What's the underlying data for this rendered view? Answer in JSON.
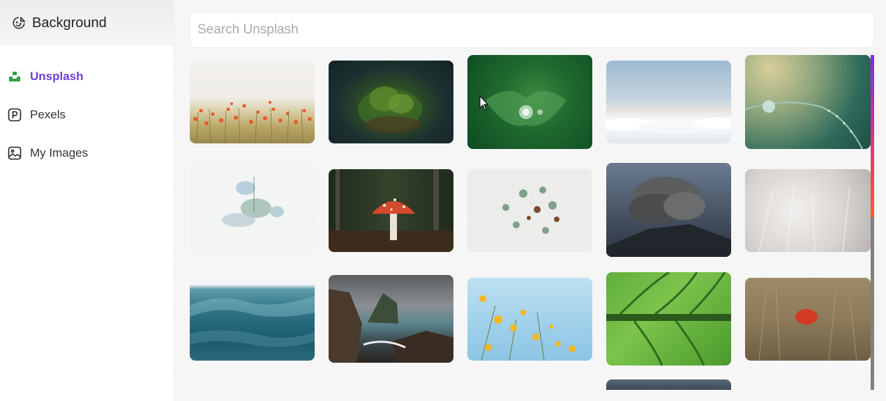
{
  "sidebar": {
    "title": "Background",
    "title_icon": "smiley-sticker-icon",
    "items": [
      {
        "label": "Unsplash",
        "icon": "unsplash-logo-icon",
        "active": true
      },
      {
        "label": "Pexels",
        "icon": "pexels-logo-icon",
        "active": false
      },
      {
        "label": "My Images",
        "icon": "image-gallery-icon",
        "active": false
      }
    ]
  },
  "search": {
    "placeholder": "Search Unsplash",
    "value": ""
  },
  "colors": {
    "active": "#6b3fd6",
    "scroll_gradient": [
      "#7b2ff7",
      "#e0357b",
      "#ff5a2c"
    ]
  },
  "images": [
    {
      "subject": "red poppies in wheat field"
    },
    {
      "subject": "moss on forest stump"
    },
    {
      "subject": "water droplet on green leaf"
    },
    {
      "subject": "clouds above horizon"
    },
    {
      "subject": "dew drops on grass blade"
    },
    {
      "subject": "pale blue flowers arrangement"
    },
    {
      "subject": "red fly agaric mushroom in forest"
    },
    {
      "subject": "succulents flat lay"
    },
    {
      "subject": "volcano eruption smoke"
    },
    {
      "subject": "misty white grass"
    },
    {
      "subject": "ocean waves"
    },
    {
      "subject": "rocky sea cliffs"
    },
    {
      "subject": "yellow cosmos flowers against sky"
    },
    {
      "subject": "green leaf veins close-up"
    },
    {
      "subject": "red poppy in golden field"
    },
    {
      "subject": "dark landscape (partially visible)"
    }
  ]
}
